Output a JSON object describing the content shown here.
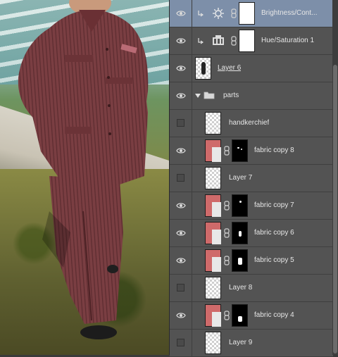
{
  "canvas": {
    "description_name": "photo canvas"
  },
  "layers": [
    {
      "name": "Brightness/Cont...",
      "visible": true,
      "type": "adjustment",
      "adjustment_icon": "sun-icon",
      "clipped": true,
      "selected": true
    },
    {
      "name": "Hue/Saturation 1",
      "visible": true,
      "type": "adjustment",
      "adjustment_icon": "hue-saturation-icon",
      "clipped": true,
      "selected": false
    },
    {
      "name": "Layer 6",
      "visible": true,
      "type": "pixel",
      "underline": true
    },
    {
      "name": "parts",
      "visible": true,
      "type": "group",
      "expanded": true
    },
    {
      "name": "handkerchief",
      "visible": false,
      "type": "pixel"
    },
    {
      "name": "fabric copy 8",
      "visible": true,
      "type": "masked"
    },
    {
      "name": "Layer 7",
      "visible": false,
      "type": "pixel"
    },
    {
      "name": "fabric copy 7",
      "visible": true,
      "type": "masked"
    },
    {
      "name": "fabric copy 6",
      "visible": true,
      "type": "masked"
    },
    {
      "name": "fabric copy 5",
      "visible": true,
      "type": "masked"
    },
    {
      "name": "Layer 8",
      "visible": false,
      "type": "pixel"
    },
    {
      "name": "fabric copy 4",
      "visible": true,
      "type": "masked"
    },
    {
      "name": "Layer 9",
      "visible": false,
      "type": "pixel"
    }
  ],
  "colors": {
    "panel_bg": "#535353",
    "selected_row": "#7d8fa9",
    "layer_text": "#e6e6e6",
    "fabric_thumb": "#cf6a6a"
  }
}
